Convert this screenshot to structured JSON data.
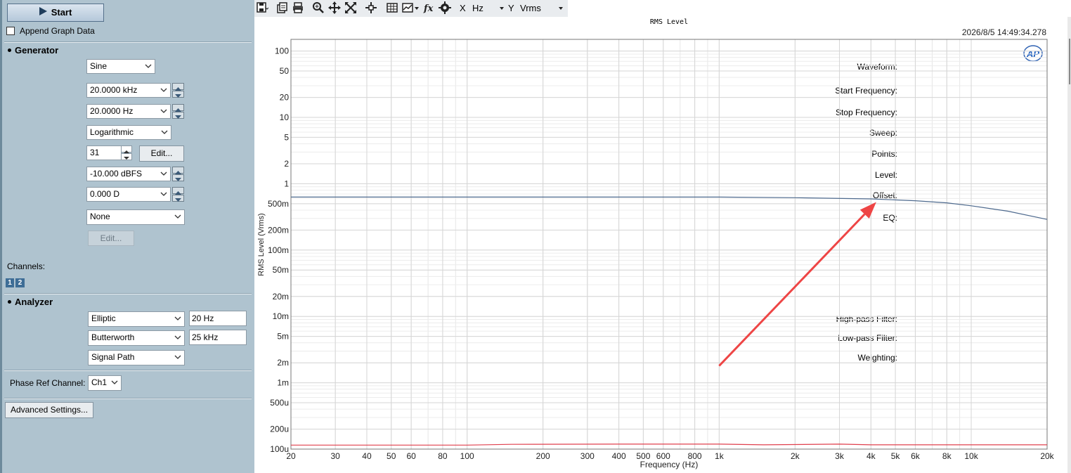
{
  "generator_panel": {
    "start_button": "Start",
    "append_graph_data": "Append Graph Data",
    "generator_header": "Generator",
    "waveform_label": "Waveform:",
    "waveform_value": "Sine",
    "start_freq_label": "Start Frequency:",
    "start_freq_value": "20.0000 kHz",
    "stop_freq_label": "Stop Frequency:",
    "stop_freq_value": "20.0000 Hz",
    "sweep_label": "Sweep:",
    "sweep_value": "Logarithmic",
    "points_label": "Points:",
    "points_value": "31",
    "points_edit": "Edit...",
    "level_label": "Level:",
    "level_value": "-10.000 dBFS",
    "offset_label": "Offset:",
    "offset_value": "0.000 D",
    "eq_label": "EQ:",
    "eq_value": "None",
    "eq_edit": "Edit...",
    "channels_label": "Channels:",
    "channel_1": "1",
    "channel_2": "2"
  },
  "analyzer_panel": {
    "analyzer_header": "Analyzer",
    "highpass_label": "High-pass Filter:",
    "highpass_type": "Elliptic",
    "highpass_freq": "20 Hz",
    "lowpass_label": "Low-pass Filter:",
    "lowpass_type": "Butterworth",
    "lowpass_freq": "25 kHz",
    "weighting_label": "Weighting:",
    "weighting_value": "Signal Path",
    "phase_ref_label": "Phase Ref Channel:",
    "phase_ref_value": "Ch1",
    "advanced_settings": "Advanced Settings..."
  },
  "toolbar": {
    "x_label": "X",
    "x_unit": "Hz",
    "y_label": "Y",
    "y_unit": "Vrms",
    "icons": [
      "save-icon",
      "copy-icon",
      "print-icon",
      "zoom-icon",
      "fit-icon",
      "autoscale-icon",
      "cursor-icon",
      "table-icon",
      "graph-style-icon",
      "fx-icon",
      "settings-icon"
    ]
  },
  "graph": {
    "title": "RMS Level",
    "timestamp": "2026/8/5 14:49:34.278",
    "logo": "AP",
    "colors": {
      "ch1": "#4e6a8e",
      "ch2": "#e0404e",
      "arrow": "#ee4545",
      "grid": "#dcdcdc"
    }
  },
  "chart_data": {
    "type": "line",
    "title": "RMS Level",
    "xlabel": "Frequency (Hz)",
    "ylabel": "RMS Level (Vrms)",
    "x_scale": "log",
    "y_scale": "log",
    "xlim": [
      20,
      20000
    ],
    "ylim": [
      0.0001,
      150
    ],
    "grid": true,
    "x_ticks": [
      20,
      30,
      40,
      50,
      60,
      80,
      100,
      200,
      300,
      400,
      500,
      600,
      800,
      1000,
      2000,
      3000,
      4000,
      5000,
      6000,
      8000,
      10000,
      20000
    ],
    "x_tick_labels": [
      "20",
      "30",
      "40",
      "50",
      "60",
      "80",
      "100",
      "200",
      "300",
      "400",
      "500",
      "600",
      "800",
      "1k",
      "2k",
      "3k",
      "4k",
      "5k",
      "6k",
      "8k",
      "10k",
      "20k"
    ],
    "y_ticks": [
      100,
      50,
      20,
      10,
      5,
      2,
      1,
      0.5,
      0.2,
      0.1,
      0.05,
      0.02,
      0.01,
      0.005,
      0.002,
      0.001,
      0.0005,
      0.0002,
      0.0001
    ],
    "y_tick_labels": [
      "100",
      "50",
      "20",
      "10",
      "5",
      "2",
      "1",
      "500m",
      "200m",
      "100m",
      "50m",
      "20m",
      "10m",
      "5m",
      "2m",
      "1m",
      "500u",
      "200u",
      "100u"
    ],
    "series": [
      {
        "x": [
          20,
          100,
          1000,
          2000,
          4000,
          6000,
          8000,
          10000,
          14000,
          20000
        ],
        "values": [
          0.63,
          0.63,
          0.63,
          0.615,
          0.59,
          0.555,
          0.515,
          0.465,
          0.385,
          0.29
        ]
      },
      {
        "x": [
          20,
          100,
          150,
          400,
          1000,
          1500,
          3000,
          4000,
          20000
        ],
        "values": [
          0.000115,
          0.000115,
          0.000118,
          0.000119,
          0.000119,
          0.000116,
          0.000119,
          0.000116,
          0.000116
        ]
      }
    ],
    "annotations": [
      {
        "type": "arrow",
        "from": [
          1000,
          0.0018
        ],
        "to": [
          4200,
          0.53
        ]
      }
    ]
  }
}
